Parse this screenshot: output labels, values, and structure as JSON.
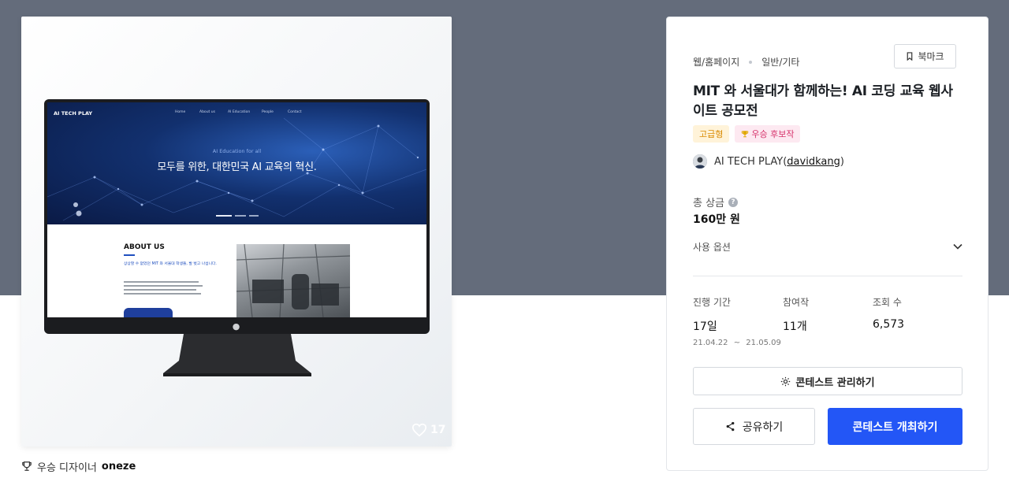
{
  "colors": {
    "page_band": "#646c7b",
    "primary": "#2356f6",
    "tier_badge_bg": "#fff3d9",
    "tier_badge_text": "#d98a00",
    "award_badge_bg": "#fde9f1",
    "award_badge_text": "#d6336c"
  },
  "preview": {
    "site_logo": "AI TECH PLAY",
    "site_nav": [
      "Home",
      "About us",
      "AI Education",
      "People",
      "Contact"
    ],
    "hero_subtitle": "AI Education for all",
    "hero_title": "모두를 위한, 대한민국 AI 교육의 혁신.",
    "about_title": "ABOUT US",
    "about_lead": "상상할 수 없었던 MIT 와 서울대 학생들, 발 벗고 나섭니다.",
    "icons": {
      "like": "heart-icon",
      "apple": "apple-logo-icon"
    },
    "likes": "17"
  },
  "designer": {
    "icon": "trophy-icon",
    "label": "우승 디자이너",
    "name": "oneze"
  },
  "panel": {
    "breadcrumb": [
      "웹/홈페이지",
      "일반/기타"
    ],
    "bookmark_label": "북마크",
    "title": "MIT 와 서울대가 함께하는! AI 코딩 교육 웹사이트 공모전",
    "badges": {
      "tier": "고급형",
      "award": "우승 후보작"
    },
    "author": {
      "name": "AI TECH PLAY",
      "handle": "davidkang"
    },
    "prize": {
      "label": "총 상금",
      "value": "160만 원"
    },
    "options_label": "사용 옵션",
    "stats": {
      "duration": {
        "label": "진행 기간",
        "value": "17일",
        "date_start": "21.04.22",
        "date_sep": "~",
        "date_end": "21.05.09"
      },
      "participants": {
        "label": "참여작",
        "value": "11개"
      },
      "views": {
        "label": "조회 수",
        "value": "6,573"
      }
    },
    "buttons": {
      "manage": "콘테스트 관리하기",
      "share": "공유하기",
      "host": "콘테스트 개최하기"
    }
  }
}
